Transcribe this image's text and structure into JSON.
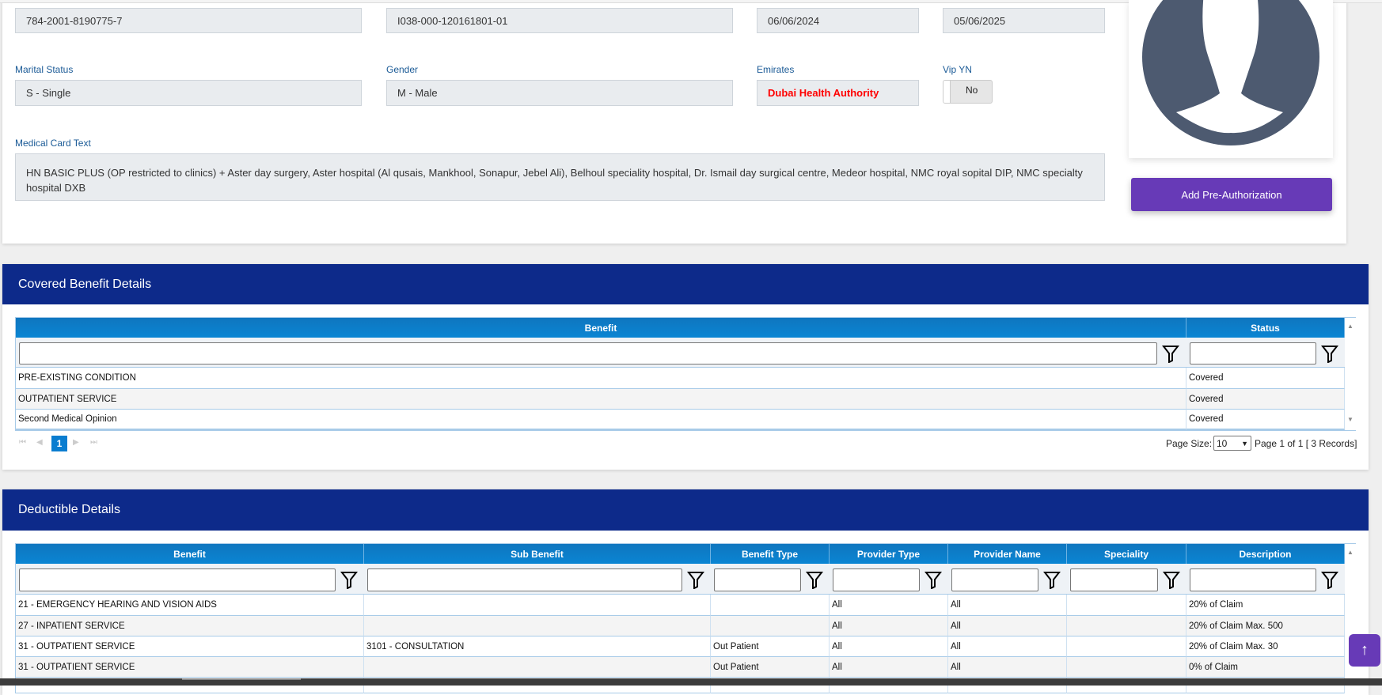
{
  "member": {
    "emirates_id": "784-2001-8190775-7",
    "card_no": "I038-000-120161801-01",
    "start_date": "06/06/2024",
    "end_date": "05/06/2025",
    "marital_label": "Marital Status",
    "marital": "S - Single",
    "gender_label": "Gender",
    "gender": "M - Male",
    "emirates_label": "Emirates",
    "emirates": "Dubai Health Authority",
    "vip_label": "Vip YN",
    "vip": "No",
    "card_text_label": "Medical Card Text",
    "card_text": "HN BASIC PLUS (OP restricted to clinics) + Aster day surgery, Aster hospital (Al qusais, Mankhool, Sonapur, Jebel Ali), Belhoul speciality hospital, Dr. Ismail day surgical centre, Medeor hospital, NMC royal sopital DIP,  NMC specialty hospital DXB",
    "add_preauth": "Add Pre-Authorization"
  },
  "covered": {
    "title": "Covered Benefit Details",
    "columns": [
      "Benefit",
      "Status"
    ],
    "rows": [
      [
        "PRE-EXISTING CONDITION",
        "Covered"
      ],
      [
        "OUTPATIENT SERVICE",
        "Covered"
      ],
      [
        "Second Medical Opinion",
        "Covered"
      ]
    ],
    "pager": {
      "page": "1",
      "page_size_label": "Page Size:",
      "page_size": "10",
      "info": "Page 1 of 1 [ 3 Records]"
    }
  },
  "deductible": {
    "title": "Deductible Details",
    "columns": [
      "Benefit",
      "Sub Benefit",
      "Benefit Type",
      "Provider Type",
      "Provider Name",
      "Speciality",
      "Description"
    ],
    "rows": [
      [
        "21 - EMERGENCY HEARING AND VISION AIDS",
        "",
        "",
        "All",
        "All",
        "",
        "20% of Claim"
      ],
      [
        "27 - INPATIENT SERVICE",
        "",
        "",
        "All",
        "All",
        "",
        "20% of Claim Max. 500"
      ],
      [
        "31 - OUTPATIENT SERVICE",
        "3101 - CONSULTATION",
        "Out Patient",
        "All",
        "All",
        "",
        "20% of Claim Max. 30"
      ],
      [
        "31 - OUTPATIENT SERVICE",
        "",
        "Out Patient",
        "All",
        "All",
        "",
        "0% of Claim"
      ]
    ]
  },
  "colors": {
    "header": "#0d2a8a",
    "accent": "#673ab7",
    "grid_header": "#0a85d3",
    "emirates_text": "#ff0000"
  }
}
